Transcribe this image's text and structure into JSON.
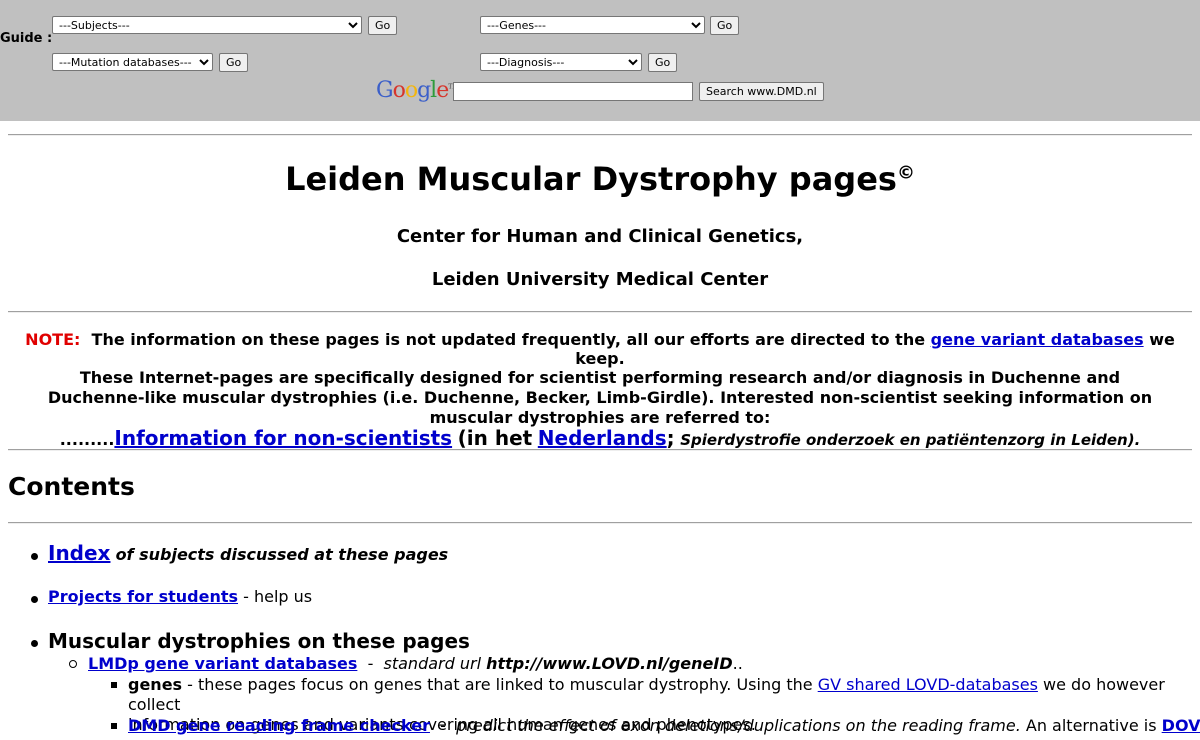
{
  "guide": {
    "label": "Guide :",
    "subjects": "---Subjects---",
    "genes": "---Genes---",
    "mutation_databases": "---Mutation databases---",
    "diagnosis": "---Diagnosis---",
    "go": "Go"
  },
  "google": {
    "logo_letters": [
      "G",
      "o",
      "o",
      "g",
      "l",
      "e"
    ],
    "logo_colors": [
      "#3b5fc9",
      "#d6352c",
      "#f2b50f",
      "#3b5fc9",
      "#2e9c3b",
      "#d6352c"
    ],
    "tm": "TM",
    "search_button": "Search www.DMD.nl",
    "search_value": ""
  },
  "header": {
    "title": "Leiden Muscular Dystrophy pages",
    "copyright": "©",
    "line1": "Center for Human and Clinical Genetics,",
    "line2": "Leiden University Medical Center"
  },
  "note": {
    "label": "NOTE:",
    "text_before": "The information on these pages is not updated frequently, all our efforts are directed to the",
    "link": "gene variant databases",
    "text_after": "we keep."
  },
  "intro": {
    "text": "These Internet-pages are specifically designed for scientist performing research and/or diagnosis in Duchenne and Duchenne-like muscular dystrophies (i.e. Duchenne, Becker, Limb-Girdle). Interested non-scientist seeking information on muscular dystrophies are referred to:",
    "dots": ".........",
    "link1": "Information for non-scientists",
    "mid": "(in het",
    "link2": "Nederlands",
    "semi": ";",
    "italic": "Spierdystrofie onderzoek en patiëntenzorg in Leiden)."
  },
  "contents": {
    "title": "Contents",
    "index_link": "Index",
    "index_text": "of subjects discussed at these pages",
    "projects_link": "Projects for students",
    "projects_text": "- help us",
    "md_heading": "Muscular dystrophies on these pages",
    "lmdp_link": "LMDp gene variant databases",
    "lmdp_dash": "-",
    "lmdp_italic": "standard url",
    "lmdp_url": "http://www.LOVD.nl/geneID",
    "lmdp_end": "..",
    "genes_label": "genes",
    "genes_text1": "- these pages focus on genes that are linked to muscular dystrophy. Using the",
    "genes_link": "GV shared LOVD-databases",
    "genes_text2": "we do however collect",
    "genes_text3": "information on genes and variants covering all human genes and phenotypes.",
    "dmd_link": "DMD gene reading frame checker",
    "dmd_dash": "-",
    "dmd_italic": "predict the effect of exon deletions/duplications on the reading frame.",
    "dmd_text": "An alternative is",
    "dove_link": "DOVE"
  }
}
